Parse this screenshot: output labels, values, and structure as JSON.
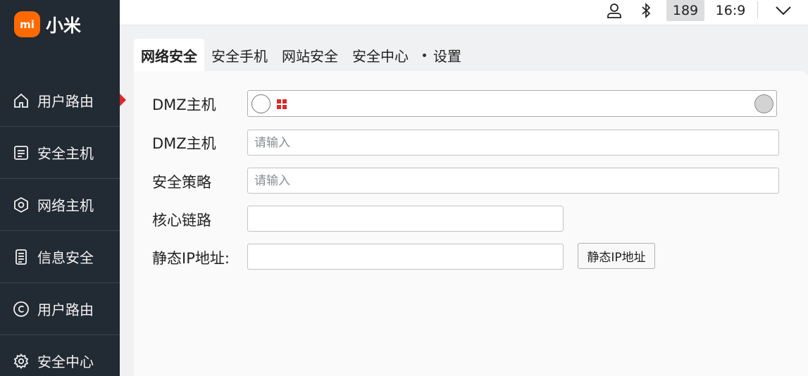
{
  "brand": {
    "logo_text": "mi",
    "name": "小米",
    "accent": "#ff6a00"
  },
  "sidebar": {
    "items": [
      {
        "label": "用户路由",
        "icon": "home-icon"
      },
      {
        "label": "安全主机",
        "icon": "list-icon"
      },
      {
        "label": "网络主机",
        "icon": "shield-hexagon-icon"
      },
      {
        "label": "信息安全",
        "icon": "document-icon"
      },
      {
        "label": "用户路由",
        "icon": "copyright-icon"
      },
      {
        "label": "安全中心",
        "icon": "gear-icon"
      }
    ]
  },
  "topbar": {
    "user_icon": "user-icon",
    "bluetooth_icon": "bluetooth-icon",
    "count": "189",
    "ratio": "16:9",
    "dropdown_icon": "chevron-down-icon"
  },
  "tabs": [
    {
      "label": "网络安全",
      "active": true
    },
    {
      "label": "安全手机",
      "active": false
    },
    {
      "label": "网站安全",
      "active": false
    },
    {
      "label": "安全中心",
      "active": false
    },
    {
      "label": "设置",
      "active": false
    }
  ],
  "form": {
    "rows": [
      {
        "label": "DMZ主机",
        "type": "select"
      },
      {
        "label": "DMZ主机",
        "placeholder": "请输入",
        "value": ""
      },
      {
        "label": "安全策略",
        "placeholder": "请输入",
        "value": ""
      },
      {
        "label": "核心链路",
        "placeholder": "",
        "value": ""
      },
      {
        "label": "静态IP地址:",
        "placeholder": "",
        "value": ""
      }
    ],
    "static_ip_button": "静态IP地址"
  },
  "colors": {
    "sidebar_bg": "#222a33",
    "active_marker": "#e0262a",
    "grid_icon": "#e0262a"
  }
}
